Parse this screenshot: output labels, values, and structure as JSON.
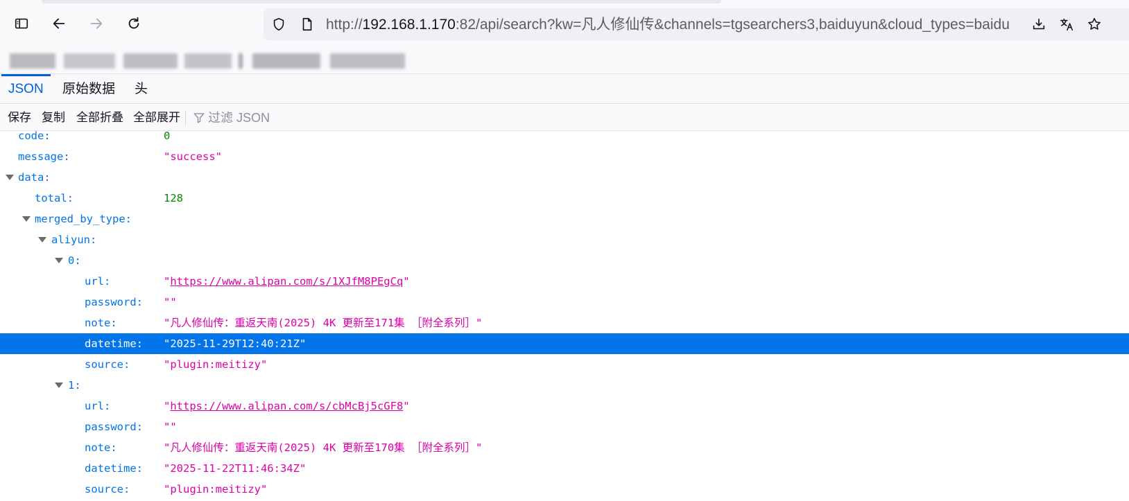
{
  "browser": {
    "url_prefix": "http://",
    "url_host": "192.168.1.170",
    "url_rest": ":82/api/search?kw=凡人修仙传&channels=tgsearchers3,baiduyun&cloud_types=baidu"
  },
  "viewer_tabs": [
    "JSON",
    "原始数据",
    "头"
  ],
  "actions": {
    "save": "保存",
    "copy": "复制",
    "collapse_all": "全部折叠",
    "expand_all": "全部展开",
    "filter_placeholder": "过滤 JSON"
  },
  "json_rows": [
    {
      "key": "code:",
      "value": "0"
    },
    {
      "key": "message:",
      "value": "\"success\""
    },
    {
      "key": "data:",
      "value": ""
    },
    {
      "key": "total:",
      "value": "128"
    },
    {
      "key": "merged_by_type:",
      "value": ""
    },
    {
      "key": "aliyun:",
      "value": ""
    },
    {
      "key": "0:",
      "value": ""
    },
    {
      "key": "url:",
      "link": "https://www.alipan.com/s/1XJfM8PEgCq"
    },
    {
      "key": "password:",
      "value": "\"\""
    },
    {
      "key": "note:",
      "value": "\"凡人修仙传：重返天南(2025) 4K 更新至171集 ［附全系列］\""
    },
    {
      "key": "datetime:",
      "value": "\"2025-11-29T12:40:21Z\""
    },
    {
      "key": "source:",
      "value": "\"plugin:meitizy\""
    },
    {
      "key": "1:",
      "value": ""
    },
    {
      "key": "url:",
      "link": "https://www.alipan.com/s/cbMcBj5cGF8"
    },
    {
      "key": "password:",
      "value": "\"\""
    },
    {
      "key": "note:",
      "value": "\"凡人修仙传：重返天南(2025) 4K 更新至170集 ［附全系列］\""
    },
    {
      "key": "datetime:",
      "value": "\"2025-11-22T11:46:34Z\""
    },
    {
      "key": "source:",
      "value": "\"plugin:meitizy\""
    }
  ],
  "colors": {
    "key": "#0074e8",
    "number": "#058b00",
    "string": "#dd00a9",
    "selection": "#0074e8"
  }
}
